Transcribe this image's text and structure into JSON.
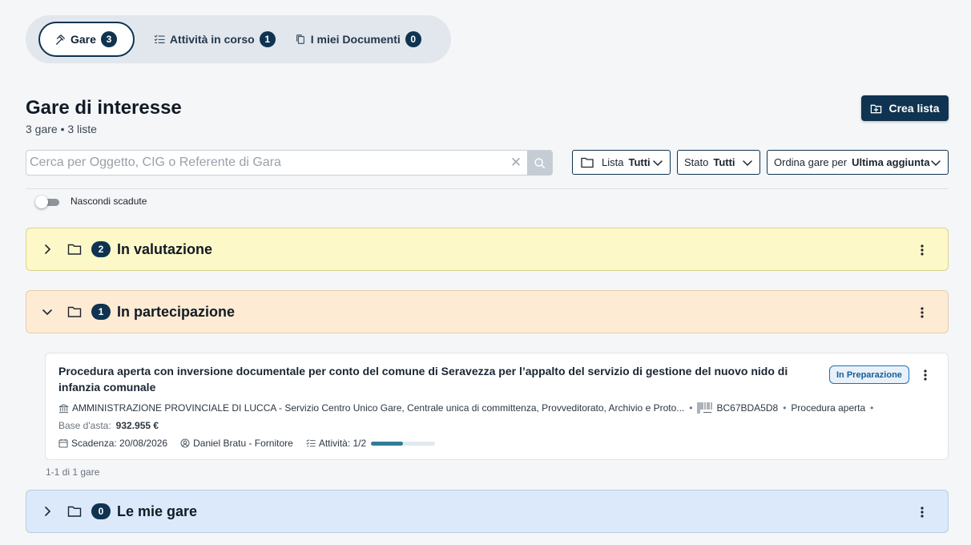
{
  "tabs": [
    {
      "label": "Gare",
      "count": "3",
      "icon": "gavel-icon",
      "active": true
    },
    {
      "label": "Attività in corso",
      "count": "1",
      "icon": "checklist-icon"
    },
    {
      "label": "I miei Documenti",
      "count": "0",
      "icon": "documents-icon"
    }
  ],
  "header": {
    "title": "Gare di interesse",
    "subtitle": "3 gare • 3 liste",
    "create_label": "Crea lista"
  },
  "search": {
    "placeholder": "Cerca per Oggetto, CIG o Referente di Gara",
    "value": "",
    "clear_glyph": "✕"
  },
  "filters": {
    "lista": {
      "label": "Lista",
      "value": "Tutti"
    },
    "stato": {
      "label": "Stato",
      "value": "Tutti"
    },
    "ordina": {
      "label": "Ordina gare per",
      "value": "Ultima aggiunta"
    }
  },
  "toggle": {
    "label": "Nascondi scadute",
    "on": false
  },
  "sections": [
    {
      "title": "In valutazione",
      "count": "2",
      "expanded": false
    },
    {
      "title": "In partecipazione",
      "count": "1",
      "expanded": true
    },
    {
      "title": "Le mie gare",
      "count": "0",
      "expanded": false
    }
  ],
  "card": {
    "title": "Procedura aperta con inversione documentale per conto del comune di Seravezza per l’appalto del servizio di gestione del nuovo nido di infanzia comunale",
    "status": "In Preparazione",
    "authority": "AMMINISTRAZIONE PROVINCIALE DI LUCCA - Servizio Centro Unico Gare, Centrale unica di committenza, Provveditorato, Archivio e Proto...",
    "cig": "BC67BDA5D8",
    "procedure": "Procedura aperta",
    "base_label": "Base d'asta:",
    "base_value": "932.955 €",
    "deadline": "Scadenza: 20/08/2026",
    "referent": "Daniel Bratu - Fornitore",
    "activities": "Attività: 1/2",
    "activities_progress": 0.5,
    "separator": "•"
  },
  "pager": "1-1 di 1 gare",
  "colors": {
    "primary": "#0f3350",
    "progress": "#2f7d99",
    "status": "#1f6fb0"
  }
}
